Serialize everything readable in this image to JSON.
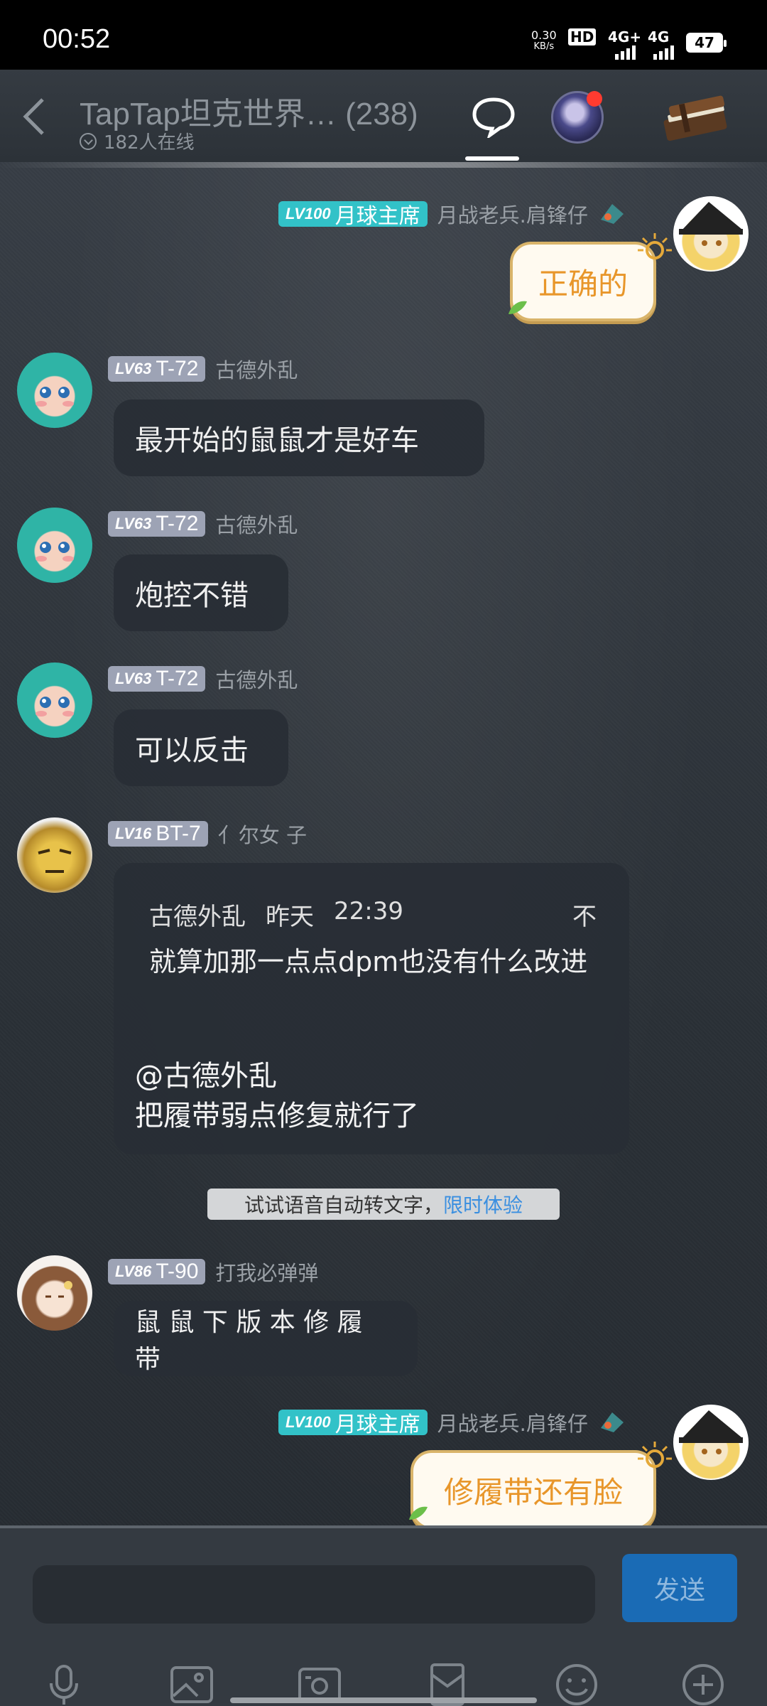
{
  "status_bar": {
    "time": "00:52",
    "net_speed_value": "0.30",
    "net_speed_unit": "KB/s",
    "hd_label": "HD",
    "sim1_label": "4G+",
    "sim2_label": "4G",
    "battery": "47"
  },
  "header": {
    "title": "TapTap坦克世界… (238)",
    "online": "182人在线"
  },
  "messages": [
    {
      "side": "right",
      "badge_lv": "LV100",
      "badge_title": "月球主席",
      "name": "月战老兵.肩锋仔",
      "text": "正确的"
    },
    {
      "side": "left",
      "badge_lv": "LV63",
      "badge_title": "T-72",
      "name": "古德外乱",
      "text": "最开始的鼠鼠才是好车"
    },
    {
      "side": "left",
      "badge_lv": "LV63",
      "badge_title": "T-72",
      "name": "古德外乱",
      "text": "炮控不错"
    },
    {
      "side": "left",
      "badge_lv": "LV63",
      "badge_title": "T-72",
      "name": "古德外乱",
      "text": "可以反击"
    },
    {
      "side": "left",
      "badge_lv": "LV16",
      "badge_title": "BT-7",
      "name": "亻尔女 子",
      "quote": {
        "author": "古德外乱",
        "day": "昨天",
        "time": "22:39",
        "close": "不",
        "text": "就算加那一点点dpm也没有什么改进"
      },
      "text": "@古德外乱\n把履带弱点修复就行了"
    },
    {
      "side": "left",
      "badge_lv": "LV86",
      "badge_title": "T-90",
      "name": "打我必弹弹",
      "text": "鼠 鼠 下 版 本 修 履 带"
    },
    {
      "side": "right",
      "badge_lv": "LV100",
      "badge_title": "月球主席",
      "name": "月战老兵.肩锋仔",
      "text": "修履带还有脸"
    }
  ],
  "tip": {
    "text": "试试语音自动转文字，",
    "highlight": "限时体验"
  },
  "composer": {
    "placeholder": "",
    "send_label": "发送"
  },
  "icons": [
    "microphone-icon",
    "image-icon",
    "camera-icon",
    "envelope-icon",
    "emoji-icon",
    "plus-icon"
  ]
}
